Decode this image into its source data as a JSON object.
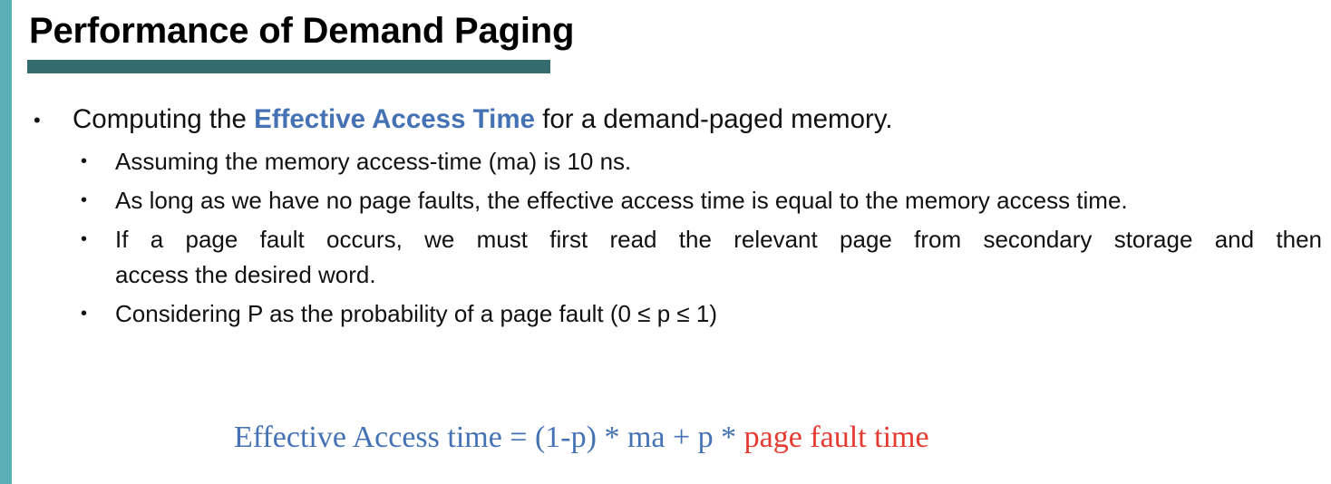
{
  "slide": {
    "title": "Performance of Demand Paging",
    "colors": {
      "accent_bar": "#5aafb6",
      "title_underline": "#336b6e",
      "highlight_blue": "#4472b4",
      "highlight_red": "#e53a2f"
    }
  },
  "bullets": {
    "main": {
      "prefix": "Computing the ",
      "highlight": "Effective Access Time",
      "suffix": " for a demand-paged memory."
    },
    "sub": [
      "Assuming the memory access-time (ma) is 10 ns.",
      "As long as we have no page faults, the effective access time is equal to the memory access time.",
      "If a page fault occurs, we must first read the relevant page from secondary storage and then",
      "access the desired word.",
      "Considering P as the probability of a page fault  (0 ≤ p ≤ 1)"
    ]
  },
  "formula": {
    "blue_part": "Effective Access time = (1-p) * ma + p * ",
    "red_part": "page fault time"
  }
}
